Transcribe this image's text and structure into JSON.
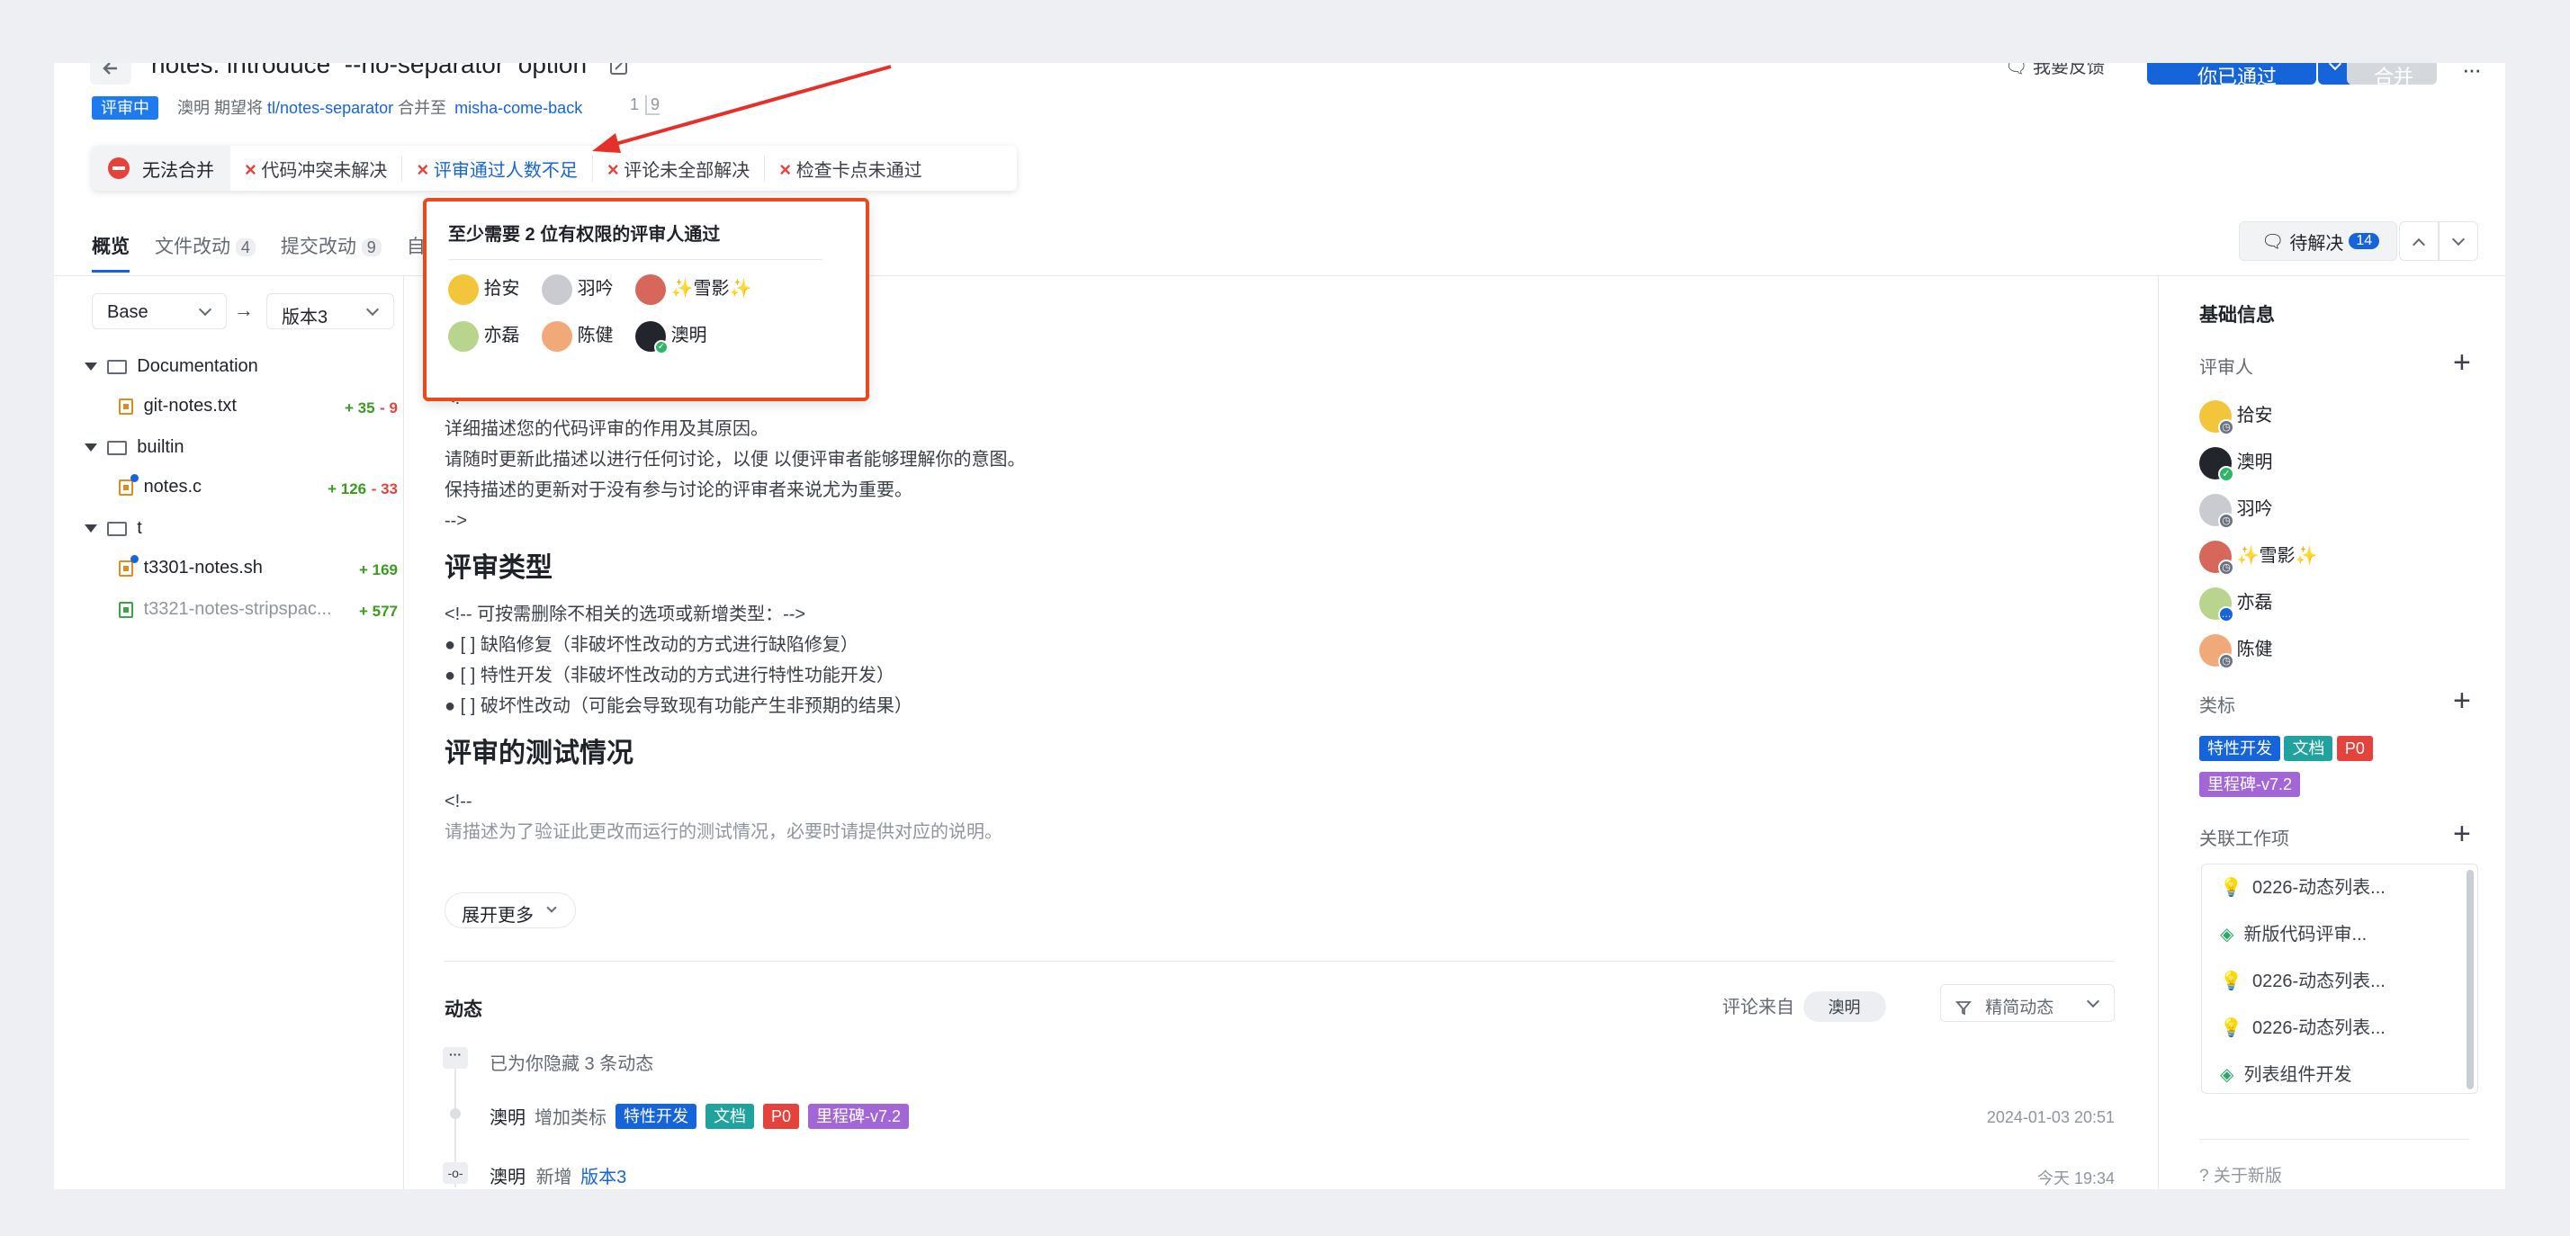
{
  "header": {
    "title": "notes: introduce  --no-separator  option",
    "status": "评审中",
    "user": "澳明",
    "text1": "期望将",
    "src_branch": "tl/notes-separator",
    "text2": "合并至",
    "target_branch": "misha-come-back",
    "num1": "1",
    "num2": "9",
    "feedback": "我要反馈",
    "approved": "你已通过",
    "merge": "合并",
    "more": "···"
  },
  "merge_checks": {
    "blocked": "无法合并",
    "items": [
      "代码冲突未解决",
      "评审通过人数不足",
      "评论未全部解决",
      "检查卡点未通过"
    ]
  },
  "popover": {
    "title": "至少需要 2 位有权限的评审人通过",
    "reviewers": [
      "拾安",
      "羽吟",
      "✨雪影✨",
      "亦磊",
      "陈健",
      "澳明"
    ]
  },
  "tabs": [
    {
      "label": "概览",
      "count": ""
    },
    {
      "label": "文件改动",
      "count": "4"
    },
    {
      "label": "提交改动",
      "count": "9"
    },
    {
      "label": "自",
      "count": ""
    }
  ],
  "pending": {
    "label": "待解决",
    "count": "14"
  },
  "compare": {
    "base": "Base",
    "arrow": "→",
    "version": "版本3"
  },
  "file_tree": [
    {
      "type": "folder",
      "name": "Documentation"
    },
    {
      "type": "file",
      "name": "git-notes.txt",
      "add": "+ 35",
      "del": "- 9"
    },
    {
      "type": "folder",
      "name": "builtin"
    },
    {
      "type": "file",
      "name": "notes.c",
      "add": "+ 126",
      "del": "- 33"
    },
    {
      "type": "folder",
      "name": "t"
    },
    {
      "type": "file",
      "name": "t3301-notes.sh",
      "add": "+ 169",
      "del": ""
    },
    {
      "type": "newfile",
      "name": "t3321-notes-stripspac...",
      "add": "+ 577",
      "del": ""
    }
  ],
  "description": {
    "lines": [
      "<!--",
      "详细描述您的代码评审的作用及其原因。",
      "请随时更新此描述以进行任何讨论，以便 以便评审者能够理解你的意图。",
      "保持描述的更新对于没有参与讨论的评审者来说尤为重要。",
      "-->"
    ],
    "h_type": "评审类型",
    "type_lines": [
      "<!-- 可按需删除不相关的选项或新增类型：-->",
      "[ ] 缺陷修复（非破坏性改动的方式进行缺陷修复）",
      "[ ] 特性开发（非破坏性改动的方式进行特性功能开发）",
      "[ ] 破坏性改动（可能会导致现有功能产生非预期的结果）"
    ],
    "h_test": "评审的测试情况",
    "test_lines": [
      "<!--",
      "请描述为了验证此更改而运行的测试情况，必要时请提供对应的说明。"
    ],
    "expand": "展开更多"
  },
  "activity": {
    "title": "动态",
    "filter_label": "评论来自",
    "filter_user": "澳明",
    "mode": "精简动态",
    "hidden": "已为你隐藏 3 条动态",
    "rows": [
      {
        "user": "澳明",
        "action": "增加类标",
        "time": "2024-01-03 20:51"
      },
      {
        "user": "澳明",
        "action": "新增",
        "link": "版本3",
        "time": "今天 19:34"
      }
    ]
  },
  "sidebar": {
    "basic_info": "基础信息",
    "reviewers_label": "评审人",
    "reviewers": [
      "拾安",
      "澳明",
      "羽吟",
      "✨雪影✨",
      "亦磊",
      "陈健"
    ],
    "labels_label": "类标",
    "labels": [
      "特性开发",
      "文档",
      "P0",
      "里程碑-v7.2"
    ],
    "work_items_label": "关联工作项",
    "work_items": [
      "0226-动态列表...",
      "新版代码评审...",
      "0226-动态列表...",
      "0226-动态列表...",
      "列表组件开发"
    ],
    "about": "关于新版"
  },
  "colors": {
    "accent": "#1664d9",
    "danger": "#e5423c",
    "annotation": "#e84a1c"
  }
}
